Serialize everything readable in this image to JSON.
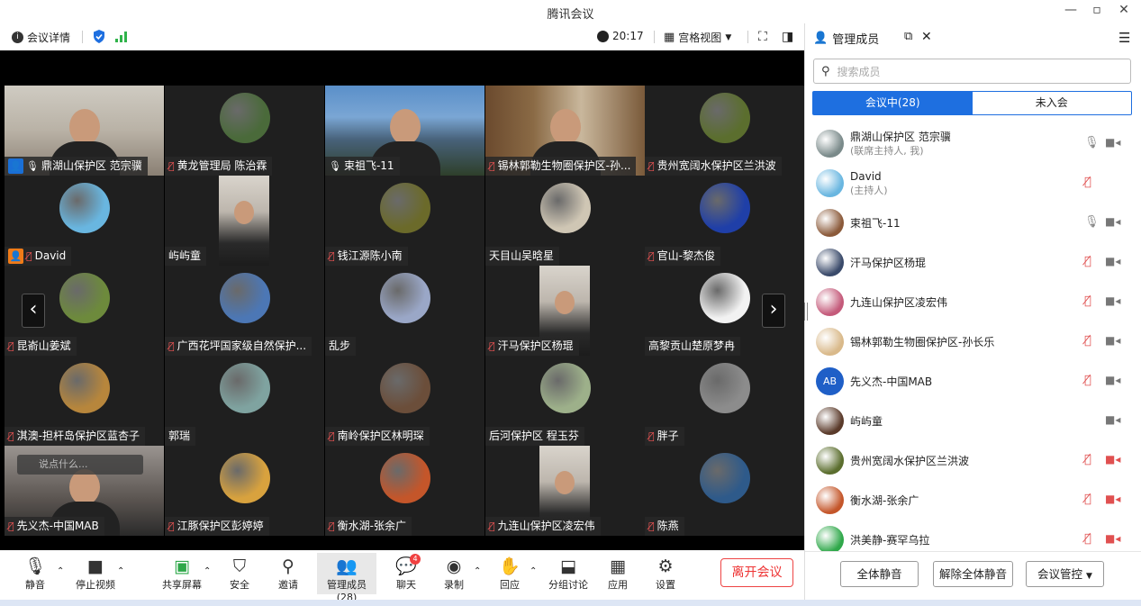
{
  "window": {
    "title": "腾讯会议",
    "minimize": "—",
    "maximize": "▫",
    "close": "✕"
  },
  "toolbar": {
    "meeting_info": "会议详情",
    "time": "20:17",
    "view_mode": "宫格视图"
  },
  "tiles": [
    {
      "name": "鼎湖山保护区 范宗骥",
      "mic": "on",
      "host_badge": "blue",
      "kind": "camera"
    },
    {
      "name": "黄龙管理局 陈治霖",
      "mic": "off",
      "kind": "avatar",
      "color": "#4a6a3a"
    },
    {
      "name": "束祖飞-11",
      "mic": "on",
      "kind": "camera",
      "active": true
    },
    {
      "name": "锡林郭勒生物圈保护区-孙...",
      "mic": "off",
      "kind": "camera"
    },
    {
      "name": "贵州宽阔水保护区兰洪波",
      "mic": "off",
      "kind": "avatar",
      "color": "#5b6e2e"
    },
    {
      "name": "David",
      "mic": "off",
      "host_badge": "orange",
      "kind": "avatar",
      "color": "#69b6e0"
    },
    {
      "name": "屿屿童",
      "mic": "none",
      "kind": "portrait"
    },
    {
      "name": "钱江源陈小南",
      "mic": "off",
      "kind": "avatar",
      "color": "#6b6a2a"
    },
    {
      "name": "天目山吴晗星",
      "mic": "none",
      "kind": "avatar",
      "color": "#cfc6b4"
    },
    {
      "name": "官山-黎杰俊",
      "mic": "off",
      "kind": "avatar",
      "color": "#1f3fa8"
    },
    {
      "name": "昆嵛山姜斌",
      "mic": "off",
      "kind": "avatar",
      "color": "#6d8a3c"
    },
    {
      "name": "广西花坪国家级自然保护...",
      "mic": "off",
      "kind": "avatar",
      "color": "#4c77b5"
    },
    {
      "name": "乱步",
      "mic": "none",
      "kind": "avatar",
      "color": "#9aa7c7"
    },
    {
      "name": "汗马保护区杨琨",
      "mic": "off",
      "kind": "portrait"
    },
    {
      "name": "高黎贡山楚原梦冉",
      "mic": "none",
      "kind": "avatar",
      "color": "#f2f2f2"
    },
    {
      "name": "淇澳-担杆岛保护区蓝杏子",
      "mic": "off",
      "kind": "avatar",
      "color": "#b7863c"
    },
    {
      "name": "郭瑞",
      "mic": "none",
      "kind": "avatar",
      "color": "#7fa3a0"
    },
    {
      "name": "南岭保护区林明琛",
      "mic": "off",
      "kind": "avatar",
      "color": "#6b4e3a"
    },
    {
      "name": "后河保护区 程玉芬",
      "mic": "none",
      "kind": "avatar",
      "color": "#9db08a"
    },
    {
      "name": "胖子",
      "mic": "off",
      "kind": "avatar",
      "color": "#8c8c8c"
    },
    {
      "name": "先义杰-中国MAB",
      "mic": "off",
      "kind": "camera",
      "chat_placeholder": "说点什么..."
    },
    {
      "name": "江豚保护区彭婷婷",
      "mic": "off",
      "kind": "avatar",
      "color": "#d8a23e"
    },
    {
      "name": "衡水湖-张余广",
      "mic": "off",
      "kind": "avatar",
      "color": "#c4562a"
    },
    {
      "name": "九连山保护区凌宏伟",
      "mic": "off",
      "kind": "portrait"
    },
    {
      "name": "陈燕",
      "mic": "off",
      "kind": "avatar",
      "color": "#2e5a8a"
    }
  ],
  "bottom": {
    "mute": "静音",
    "stop_video": "停止视频",
    "share": "共享屏幕",
    "security": "安全",
    "invite": "邀请",
    "members": "管理成员(28)",
    "chat": "聊天",
    "chat_badge": "4",
    "record": "录制",
    "reaction": "回应",
    "breakout": "分组讨论",
    "apps": "应用",
    "settings": "设置",
    "leave": "离开会议"
  },
  "panel": {
    "title": "管理成员",
    "search_placeholder": "搜索成员",
    "tab_in": "会议中(28)",
    "tab_out": "未入会",
    "members": [
      {
        "name": "鼎湖山保护区 范宗骥",
        "sub": "(联席主持人, 我)",
        "mic": "on",
        "cam": "on",
        "color": "#7a8a8a"
      },
      {
        "name": "David",
        "sub": "(主持人)",
        "mic": "off",
        "cam": "none",
        "color": "#69b6e0"
      },
      {
        "name": "束祖飞-11",
        "mic": "on",
        "cam": "on",
        "color": "#8b5a3a"
      },
      {
        "name": "汗马保护区杨琨",
        "mic": "off",
        "cam": "on",
        "color": "#3a4a6a"
      },
      {
        "name": "九连山保护区凌宏伟",
        "mic": "off",
        "cam": "on",
        "color": "#c45a7a"
      },
      {
        "name": "锡林郭勒生物圈保护区-孙长乐",
        "mic": "off",
        "cam": "on",
        "color": "#d9b98a"
      },
      {
        "name": "先义杰-中国MAB",
        "mic": "off",
        "cam": "on",
        "color": "#1f5fc7",
        "initials": "AB"
      },
      {
        "name": "屿屿童",
        "mic": "none",
        "cam": "on",
        "color": "#5a3a2a"
      },
      {
        "name": "贵州宽阔水保护区兰洪波",
        "mic": "off",
        "cam": "off",
        "color": "#5b6e2e"
      },
      {
        "name": "衡水湖-张余广",
        "mic": "off",
        "cam": "off",
        "color": "#c4562a"
      },
      {
        "name": "洪美静-赛罕乌拉",
        "mic": "off",
        "cam": "off",
        "color": "#2fa84a"
      }
    ],
    "mute_all": "全体静音",
    "unmute_all": "解除全体静音",
    "control": "会议管控"
  }
}
